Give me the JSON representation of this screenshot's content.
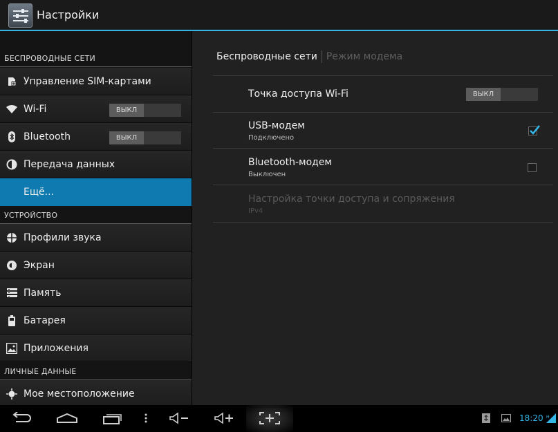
{
  "app": {
    "title": "Настройки",
    "icon": "settings-sliders-icon",
    "accent": "#33b5e5",
    "active_color": "#0f7ab0"
  },
  "sidebar": {
    "sections": [
      {
        "header": "БЕСПРОВОДНЫЕ СЕТИ",
        "items": [
          {
            "label": "Управление SIM-картами",
            "icon": "sim-card-icon"
          },
          {
            "label": "Wi-Fi",
            "icon": "wifi-icon",
            "switch": "ВЫКЛ"
          },
          {
            "label": "Bluetooth",
            "icon": "bluetooth-icon",
            "switch": "ВЫКЛ"
          },
          {
            "label": "Передача данных",
            "icon": "data-usage-icon"
          },
          {
            "label": "Ещё...",
            "icon": "",
            "active": true
          }
        ]
      },
      {
        "header": "УСТРОЙСТВО",
        "items": [
          {
            "label": "Профили звука",
            "icon": "sound-profile-icon"
          },
          {
            "label": "Экран",
            "icon": "display-icon"
          },
          {
            "label": "Память",
            "icon": "storage-icon"
          },
          {
            "label": "Батарея",
            "icon": "battery-icon"
          },
          {
            "label": "Приложения",
            "icon": "apps-icon"
          }
        ]
      },
      {
        "header": "ЛИЧНЫЕ ДАННЫЕ",
        "items": [
          {
            "label": "Мое местоположение",
            "icon": "location-icon"
          }
        ]
      }
    ]
  },
  "main": {
    "tabs": [
      {
        "label": "Беспроводные сети",
        "active": true
      },
      {
        "label": "Режим модема",
        "active": false
      }
    ],
    "prefs": [
      {
        "title": "Точка доступа Wi-Fi",
        "summary": "",
        "control": "switch",
        "switch_label": "ВЫКЛ",
        "enabled": true
      },
      {
        "title": "USB-модем",
        "summary": "Подключено",
        "control": "checkbox",
        "checked": true,
        "enabled": true
      },
      {
        "title": "Bluetooth-модем",
        "summary": "Выключен",
        "control": "checkbox",
        "checked": false,
        "enabled": true
      },
      {
        "title": "Настройка точки доступа и сопряжения",
        "summary": "IPv4",
        "control": "none",
        "enabled": false
      }
    ]
  },
  "navbar": {
    "buttons": [
      "back-icon",
      "home-icon",
      "recent-apps-icon",
      "menu-dots-icon",
      "volume-down-icon",
      "volume-up-icon",
      "screenshot-icon"
    ],
    "status_icons": [
      "usb-debug-icon",
      "image-notification-icon",
      "signal-icon"
    ],
    "time": "18:20"
  }
}
